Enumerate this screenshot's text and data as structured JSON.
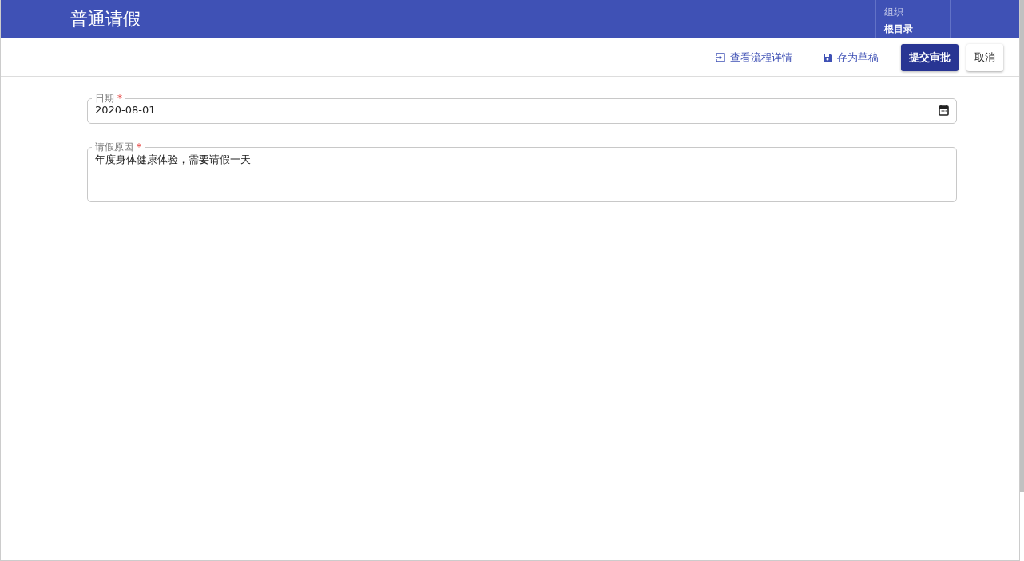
{
  "header": {
    "title": "普通请假",
    "org_label": "组织",
    "org_value": "根目录"
  },
  "toolbar": [
    {
      "kind": "flow",
      "label": "查看流程详情"
    },
    {
      "kind": "draft",
      "label": "存为草稿"
    },
    {
      "kind": "primary",
      "label": "提交审批"
    },
    {
      "kind": "plain",
      "label": "取消"
    }
  ],
  "fields": [
    {
      "kind": "date",
      "label": "日期",
      "required_mark": "*",
      "value": "2020-08-01"
    },
    {
      "kind": "textarea",
      "label": "请假原因",
      "required_mark": "*",
      "value": "年度身体健康体验，需要请假一天"
    }
  ]
}
